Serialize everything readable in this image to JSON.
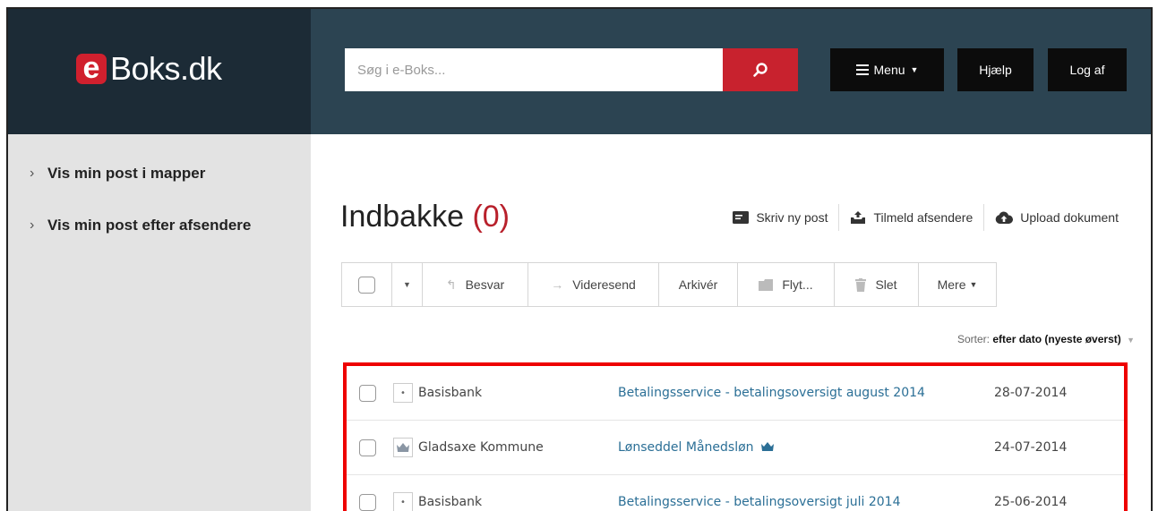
{
  "header": {
    "logo_letter": "e",
    "logo_text": "Boks.dk",
    "search_placeholder": "Søg i e-Boks...",
    "menu_label": "Menu",
    "help_label": "Hjælp",
    "logout_label": "Log af",
    "brand_color": "#c8222e"
  },
  "sidebar": {
    "items": [
      {
        "label": "Vis min post i mapper"
      },
      {
        "label": "Vis min post efter afsendere"
      }
    ]
  },
  "main": {
    "title": "Indbakke",
    "count": "(0)",
    "actions": [
      {
        "label": "Skriv ny post",
        "icon": "compose-icon"
      },
      {
        "label": "Tilmeld afsendere",
        "icon": "inbox-upload-icon"
      },
      {
        "label": "Upload dokument",
        "icon": "cloud-upload-icon"
      }
    ],
    "toolbar": {
      "reply": "Besvar",
      "forward": "Videresend",
      "archive": "Arkivér",
      "move": "Flyt...",
      "delete": "Slet",
      "more": "Mere"
    },
    "sort": {
      "label": "Sorter:",
      "value": "efter dato (nyeste øverst)"
    },
    "messages": [
      {
        "sender": "Basisbank",
        "subject": "Betalingsservice - betalingsoversigt august 2014",
        "date": "28-07-2014",
        "icon": "dot-icon"
      },
      {
        "sender": "Gladsaxe Kommune",
        "subject": "Lønseddel Månedsløn",
        "date": "24-07-2014",
        "icon": "crown-icon"
      },
      {
        "sender": "Basisbank",
        "subject": "Betalingsservice - betalingsoversigt juli 2014",
        "date": "25-06-2014",
        "icon": "dot-icon"
      }
    ]
  }
}
